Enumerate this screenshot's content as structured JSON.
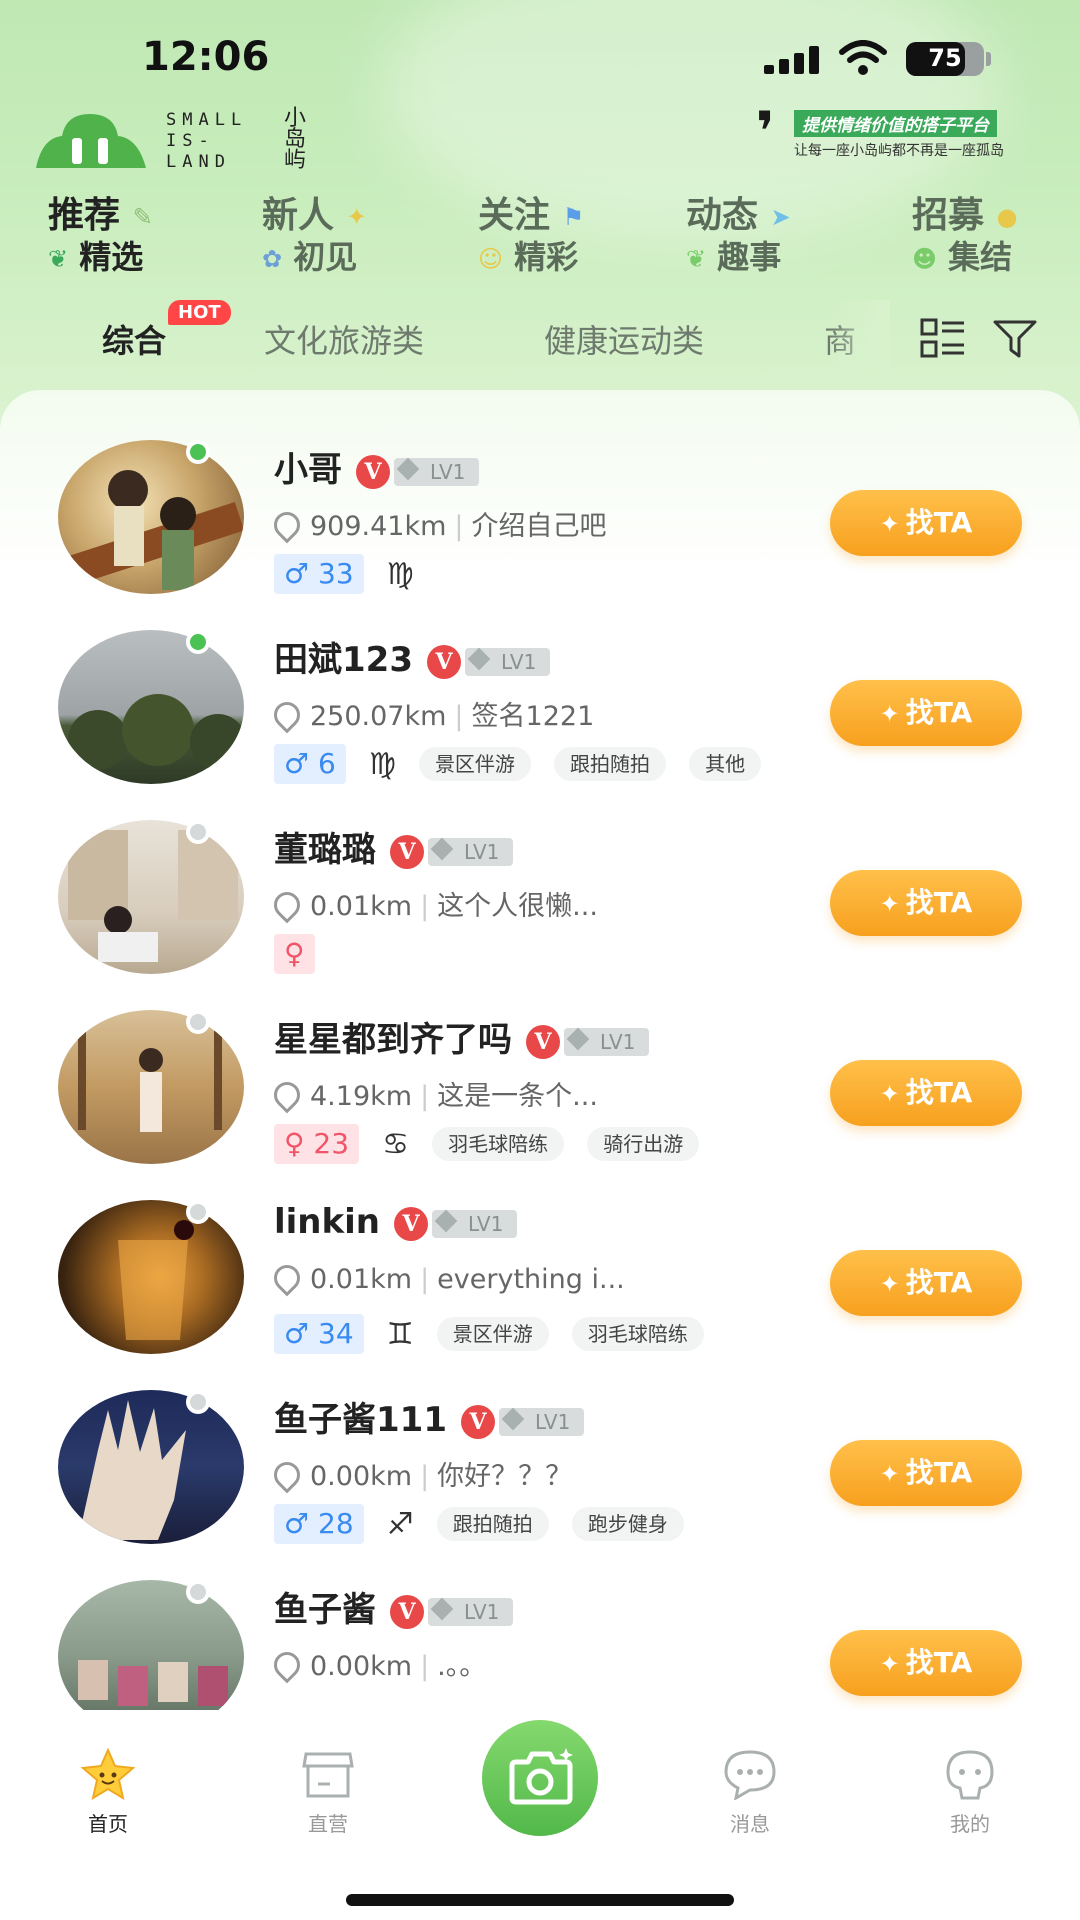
{
  "status_bar": {
    "time": "12:06",
    "battery": "75",
    "battery_level": 0.75
  },
  "header": {
    "logo_text": "SMALL\nIS-\nLAND",
    "logo_cn": "小岛屿",
    "slogan_main": "提供情绪价值的搭子平台",
    "slogan_sub": "让每一座小岛屿都不再是一座孤岛"
  },
  "categories": [
    {
      "title": "推荐",
      "sub": "精选"
    },
    {
      "title": "新人",
      "sub": "初见"
    },
    {
      "title": "关注",
      "sub": "精彩"
    },
    {
      "title": "动态",
      "sub": "趣事"
    },
    {
      "title": "招募",
      "sub": "集结"
    }
  ],
  "tabs": {
    "hot": "HOT",
    "items": [
      "综合",
      "文化旅游类",
      "健康运动类",
      "商"
    ]
  },
  "find_label": "找TA",
  "users": [
    {
      "name": "小哥",
      "level": "LV1",
      "distance": "909.41km",
      "bio": "介绍自己吧",
      "gender": "♂",
      "age": "33",
      "zodiac": "♍",
      "tags": [],
      "online": true
    },
    {
      "name": "田斌123",
      "level": "LV1",
      "distance": "250.07km",
      "bio": "签名1221",
      "gender": "♂",
      "age": "6",
      "zodiac": "♍",
      "tags": [
        "景区伴游",
        "跟拍随拍",
        "其他"
      ],
      "online": true
    },
    {
      "name": "董璐璐",
      "level": "LV1",
      "distance": "0.01km",
      "bio": "这个人很懒...",
      "gender": "♀",
      "age": "",
      "zodiac": "",
      "tags": [],
      "online": false
    },
    {
      "name": "星星都到齐了吗",
      "level": "LV1",
      "distance": "4.19km",
      "bio": "这是一条个...",
      "gender": "♀",
      "age": "23",
      "zodiac": "♋",
      "tags": [
        "羽毛球陪练",
        "骑行出游"
      ],
      "online": false
    },
    {
      "name": "linkin",
      "level": "LV1",
      "distance": "0.01km",
      "bio": "everything i...",
      "gender": "♂",
      "age": "34",
      "zodiac": "♊",
      "tags": [
        "景区伴游",
        "羽毛球陪练"
      ],
      "online": false
    },
    {
      "name": "鱼子酱111",
      "level": "LV1",
      "distance": "0.00km",
      "bio": "你好？？？",
      "gender": "♂",
      "age": "28",
      "zodiac": "♐",
      "tags": [
        "跟拍随拍",
        "跑步健身"
      ],
      "online": false
    },
    {
      "name": "鱼子酱",
      "level": "LV1",
      "distance": "0.00km",
      "bio": ".。。",
      "gender": "♂",
      "age": "",
      "zodiac": "",
      "tags": [],
      "online": false
    }
  ],
  "bottom_nav": [
    {
      "label": "首页",
      "icon": "star-home-icon",
      "active": true
    },
    {
      "label": "直营",
      "icon": "store-icon",
      "active": false
    },
    {
      "label": "",
      "icon": "camera-icon",
      "active": false
    },
    {
      "label": "消息",
      "icon": "chat-bubble-icon",
      "active": false
    },
    {
      "label": "我的",
      "icon": "profile-icon",
      "active": false
    }
  ],
  "colors": {
    "brand_green": "#52b84a",
    "find_button": "#f7a01e",
    "vip_red": "#e84848",
    "online_green": "#4cc254",
    "male_blue": "#3a8bf0",
    "female_pink": "#f0566a"
  }
}
